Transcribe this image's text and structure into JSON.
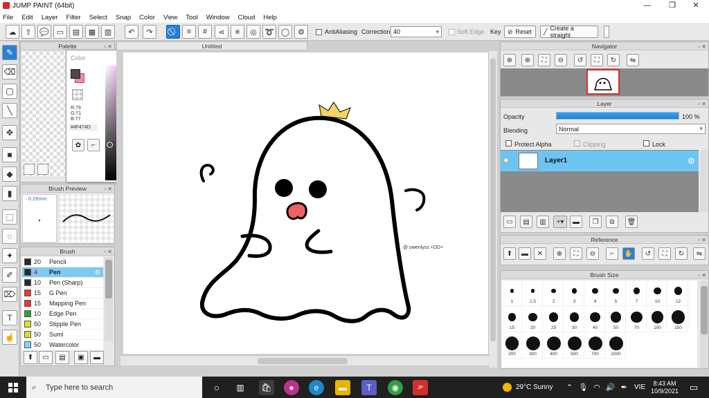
{
  "window": {
    "title": "JUMP PAINT (64bit)",
    "controls": [
      "—",
      "❐",
      "✕"
    ]
  },
  "menu": [
    "File",
    "Edit",
    "Layer",
    "Filter",
    "Select",
    "Snap",
    "Color",
    "View",
    "Tool",
    "Window",
    "Cloud",
    "Help"
  ],
  "toolbar": {
    "antialiasing_label": "AntiAliasing",
    "correction_label": "Correction",
    "correction_value": "40",
    "soft_edge_label": "Soft Edge",
    "key_label": "Key",
    "reset_label": "Reset",
    "straight_label": "Create a straight"
  },
  "panels": {
    "palette_title": "Palette",
    "color_title": "Color",
    "brush_preview_title": "Brush Preview",
    "brush_title": "Brush",
    "navigator_title": "Navigator",
    "layer_title": "Layer",
    "reference_title": "Reference",
    "brush_size_title": "Brush Size"
  },
  "color": {
    "r": "R:79",
    "g": "G:71",
    "b": "B:77",
    "hex": "#4F474D",
    "fg_hex": "#4F474D",
    "bg_hex": "#F28AB0"
  },
  "brush_preview": {
    "size": "0.29mm"
  },
  "brushes": [
    {
      "size": "20",
      "name": "Pencil",
      "color": "#2a2a2a",
      "selected": false
    },
    {
      "size": "4",
      "name": "Pen",
      "color": "#2a2a2a",
      "selected": true
    },
    {
      "size": "10",
      "name": "Pen (Sharp)",
      "color": "#2a2a2a",
      "selected": false
    },
    {
      "size": "15",
      "name": "G Pen",
      "color": "#e53935",
      "selected": false
    },
    {
      "size": "15",
      "name": "Mapping Pen",
      "color": "#e53935",
      "selected": false
    },
    {
      "size": "10",
      "name": "Edge Pen",
      "color": "#2e9e3a",
      "selected": false
    },
    {
      "size": "50",
      "name": "Stipple Pen",
      "color": "#dede20",
      "selected": false
    },
    {
      "size": "50",
      "name": "Sumi",
      "color": "#dede20",
      "selected": false
    },
    {
      "size": "50",
      "name": "Watercolor",
      "color": "#7fd7f5",
      "selected": false
    }
  ],
  "document": {
    "tab_title": "Untitled",
    "signature": "@ owenlyss +DD+"
  },
  "layer": {
    "opacity_label": "Opacity",
    "opacity_value": "100 %",
    "opacity_fraction": 1.0,
    "blending_label": "Blending",
    "blending_value": "Normal",
    "protect_alpha_label": "Protect Alpha",
    "clipping_label": "Clipping",
    "lock_label": "Lock",
    "layer_name": "Layer1"
  },
  "brush_sizes": [
    "1",
    "1.5",
    "2",
    "3",
    "4",
    "5",
    "7",
    "10",
    "12",
    "15",
    "20",
    "25",
    "30",
    "40",
    "50",
    "70",
    "100",
    "150",
    "200",
    "300",
    "400",
    "500",
    "700",
    "1000"
  ],
  "taskbar": {
    "search_placeholder": "Type here to search",
    "weather": "29°C  Sunny",
    "language": "VIE",
    "time": "8:43 AM",
    "date": "10/9/2021"
  }
}
